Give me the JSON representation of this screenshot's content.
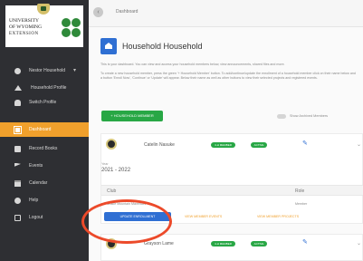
{
  "sidebar": {
    "logo": {
      "line1": "UNIVERSITY",
      "line2": "OF WYOMING",
      "line3": "EXTENSION"
    },
    "items": [
      {
        "label": "Nestor Household",
        "icon": "user-icon",
        "caret": "▾"
      },
      {
        "label": "Household Profile",
        "icon": "home-icon"
      },
      {
        "label": "Switch Profile",
        "icon": "person-icon"
      },
      {
        "label": "Dashboard",
        "icon": "dashboard-icon",
        "active": true
      },
      {
        "label": "Record Books",
        "icon": "book-icon"
      },
      {
        "label": "Events",
        "icon": "flag-icon"
      },
      {
        "label": "Calendar",
        "icon": "calendar-icon"
      },
      {
        "label": "Help",
        "icon": "help-icon"
      },
      {
        "label": "Logout",
        "icon": "logout-icon"
      }
    ]
  },
  "topbar": {
    "back": "‹",
    "breadcrumb": "Dashboard"
  },
  "main": {
    "title": "Household Household",
    "desc1": "This is your dashboard. You can view and access your household members below, view announcements, shared files and more.",
    "desc2": "To create a new household member, press the green '+ Household Member' button. To add/continue/update the enrollment of a household member click on their name below and a button 'Enroll Now', 'Continue' or 'Update' will appear. Below their name as well as other buttons to view their selected projects and registered events.",
    "add_button": "+ HOUSEHOLD MEMBER",
    "toggle_label": "Show Archived Members",
    "members": [
      {
        "name": "Catelin Nasuke",
        "badges": [
          "4-H MEMBER",
          "ACTIVE"
        ],
        "year_label": "Year",
        "year": "2021 - 2022",
        "club_header": "Club",
        "role_header": "Role",
        "club_name": "Snake Mountain Mavericks",
        "role": "Member",
        "update_button": "UPDATE ENROLLMENT",
        "events_link": "VIEW MEMBER EVENTS",
        "projects_link": "VIEW MEMBER PROJECTS"
      },
      {
        "name": "Grayson Lame",
        "badges": [
          "4-H MEMBER",
          "ACTIVE"
        ]
      }
    ]
  },
  "colors": {
    "sidebar_bg": "#2e2f33",
    "active_nav": "#f0a02c",
    "primary_blue": "#2f6fd3",
    "success_green": "#28a745",
    "highlight_red": "#ec4a2a"
  }
}
